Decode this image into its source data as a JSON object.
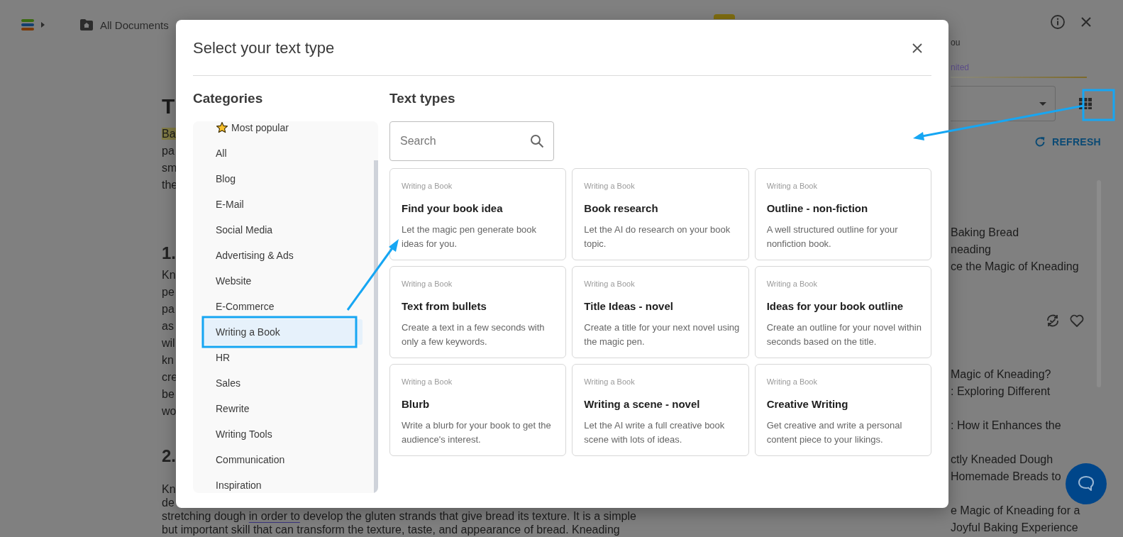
{
  "header": {
    "breadcrumb": "All Documents"
  },
  "document": {
    "blocks": [
      {
        "kind": "title",
        "text": "T"
      },
      {
        "kind": "paragraph",
        "lines": [
          {
            "kind": "highlight",
            "text": "Ba"
          },
          {
            "kind": "plain",
            "text": "pa"
          },
          {
            "kind": "plain",
            "text": "sm"
          },
          {
            "kind": "plain",
            "text": "the"
          }
        ]
      },
      {
        "kind": "heading",
        "text": "1."
      },
      {
        "kind": "paragraph",
        "lines": [
          {
            "kind": "plain",
            "text": "Kn"
          },
          {
            "kind": "plain",
            "text": "pe"
          },
          {
            "kind": "plain",
            "text": "pa"
          },
          {
            "kind": "plain",
            "text": "as"
          },
          {
            "kind": "plain",
            "text": "wil"
          },
          {
            "kind": "plain",
            "text": "kn"
          },
          {
            "kind": "plain",
            "text": "cre"
          },
          {
            "kind": "plain",
            "text": "be"
          },
          {
            "kind": "plain",
            "text": "wo"
          }
        ]
      },
      {
        "kind": "heading",
        "text": "2."
      },
      {
        "kind": "paragraph",
        "lines": [
          {
            "kind": "plain",
            "text": "Kn"
          },
          {
            "kind": "plain",
            "text": "de"
          },
          {
            "kind": "segmented",
            "segments": [
              {
                "text": "stretching dough ",
                "underlined": false
              },
              {
                "text": "in order to",
                "underlined": true
              },
              {
                "text": " develop the gluten strands that give bread its texture. It is a simple",
                "underlined": false
              }
            ]
          },
          {
            "kind": "plain",
            "text": "but important skill that can transform the texture, taste, and appearance of bread. Kneading"
          }
        ]
      }
    ]
  },
  "ai_panel": {
    "subtitle_fragment": "ou",
    "plan_fragment": "nited",
    "refresh_label": "REFRESH",
    "result_lines": [
      "Baking Bread",
      "neading",
      "ce the Magic of Kneading"
    ],
    "outline_items": [
      {
        "lines": [
          "Magic of Kneading?",
          ": Exploring Different"
        ]
      },
      {
        "lines": [
          ": How it Enhances the"
        ]
      },
      {
        "lines": [
          "ctly Kneaded Dough",
          "Homemade Breads to"
        ]
      },
      {
        "lines": [
          "e Magic of Kneading for a",
          "Joyful Baking Experience"
        ]
      }
    ]
  },
  "modal": {
    "title": "Select your text type",
    "categories_heading": "Categories",
    "text_types_heading": "Text types",
    "search": {
      "placeholder": "Search"
    },
    "categories": [
      {
        "label": "Most popular",
        "kind": "starred",
        "selected": false
      },
      {
        "label": "All",
        "kind": "plain",
        "selected": false
      },
      {
        "label": "Blog",
        "kind": "plain",
        "selected": false
      },
      {
        "label": "E-Mail",
        "kind": "plain",
        "selected": false
      },
      {
        "label": "Social Media",
        "kind": "plain",
        "selected": false
      },
      {
        "label": "Advertising & Ads",
        "kind": "plain",
        "selected": false
      },
      {
        "label": "Website",
        "kind": "plain",
        "selected": false
      },
      {
        "label": "E-Commerce",
        "kind": "plain",
        "selected": false
      },
      {
        "label": "Writing a Book",
        "kind": "plain",
        "selected": true
      },
      {
        "label": "HR",
        "kind": "plain",
        "selected": false
      },
      {
        "label": "Sales",
        "kind": "plain",
        "selected": false
      },
      {
        "label": "Rewrite",
        "kind": "plain",
        "selected": false
      },
      {
        "label": "Writing Tools",
        "kind": "plain",
        "selected": false
      },
      {
        "label": "Communication",
        "kind": "plain",
        "selected": false
      },
      {
        "label": "Inspiration",
        "kind": "plain",
        "selected": false
      }
    ],
    "cards": [
      {
        "category": "Writing a Book",
        "title": "Find your book idea",
        "description": "Let the magic pen generate book ideas for you."
      },
      {
        "category": "Writing a Book",
        "title": "Book research",
        "description": "Let the AI do research on your book topic."
      },
      {
        "category": "Writing a Book",
        "title": "Outline - non-fiction",
        "description": "A well structured outline for your nonfiction book."
      },
      {
        "category": "Writing a Book",
        "title": "Text from bullets",
        "description": "Create a text in a few seconds with only a few keywords."
      },
      {
        "category": "Writing a Book",
        "title": "Title Ideas - novel",
        "description": "Create a title for your next novel using the magic pen."
      },
      {
        "category": "Writing a Book",
        "title": "Ideas for your book outline",
        "description": "Create an outline for your novel within seconds based on the title."
      },
      {
        "category": "Writing a Book",
        "title": "Blurb",
        "description": "Write a blurb for your book to get the audience's interest."
      },
      {
        "category": "Writing a Book",
        "title": "Writing a scene - novel",
        "description": "Let the AI write a full creative book scene with lots of ideas."
      },
      {
        "category": "Writing a Book",
        "title": "Creative Writing",
        "description": "Get creative and write a personal content piece to your likings."
      }
    ]
  }
}
